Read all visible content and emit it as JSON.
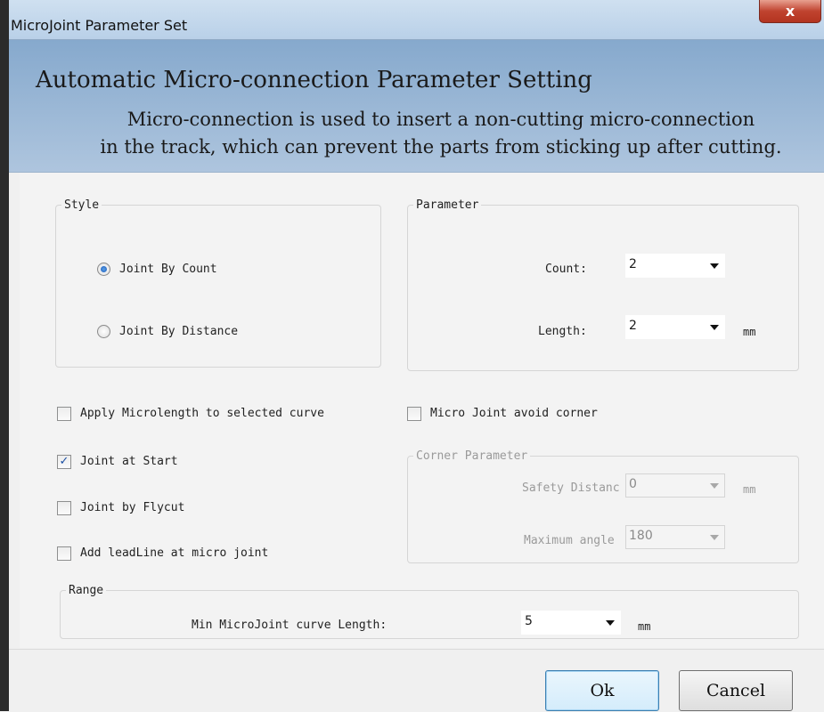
{
  "window": {
    "title": "MicroJoint Parameter Set",
    "close_glyph": "x"
  },
  "banner": {
    "heading": "Automatic Micro-connection Parameter Setting",
    "description_line1": "Micro-connection is used to insert a non-cutting micro-connection",
    "description_line2": "in the track, which can prevent the parts from sticking up after cutting."
  },
  "style_group": {
    "legend": "Style",
    "options": [
      {
        "label": "Joint By Count",
        "selected": true
      },
      {
        "label": "Joint By Distance",
        "selected": false
      }
    ]
  },
  "parameter_group": {
    "legend": "Parameter",
    "count_label": "Count:",
    "count_value": "2",
    "length_label": "Length:",
    "length_value": "2",
    "length_unit": "mm"
  },
  "checkboxes": {
    "apply_microlength": {
      "label": "Apply Microlength to selected curve",
      "checked": false
    },
    "avoid_corner": {
      "label": "Micro Joint avoid corner",
      "checked": false
    },
    "joint_at_start": {
      "label": "Joint at Start",
      "checked": true,
      "mark": "✓"
    },
    "joint_by_flycut": {
      "label": "Joint by Flycut",
      "checked": false
    },
    "add_leadline": {
      "label": "Add leadLine at micro joint",
      "checked": false
    }
  },
  "corner_group": {
    "legend": "Corner Parameter",
    "safety_label": "Safety Distanc",
    "safety_value": "0",
    "safety_unit": "mm",
    "angle_label": "Maximum angle",
    "angle_value": "180"
  },
  "range_group": {
    "legend": "Range",
    "min_length_label": "Min MicroJoint curve Length:",
    "min_length_value": "5",
    "min_length_unit": "mm"
  },
  "buttons": {
    "ok": "Ok",
    "cancel": "Cancel"
  },
  "colors": {
    "banner": "#9bb8d8",
    "titlebar": "#c4d8ec",
    "close": "#c0432f"
  }
}
